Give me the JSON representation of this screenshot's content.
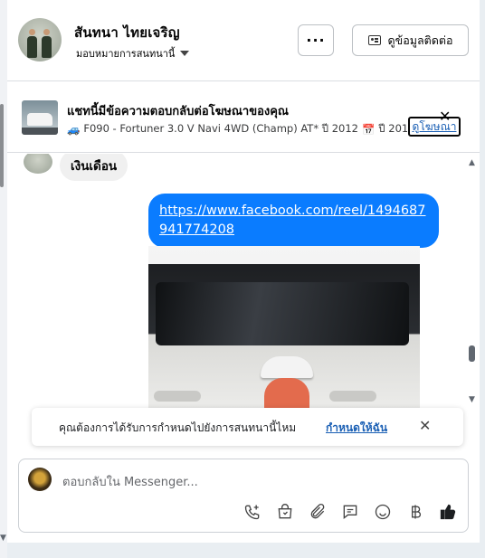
{
  "header": {
    "contact_name": "สันทนา ไทยเจริญ",
    "assign_label": "มอบหมายการสนทนานี้",
    "more_label": "···",
    "contact_info_label": "ดูข้อมูลติดต่อ"
  },
  "ad_banner": {
    "title": "แชทนี้มีข้อความตอบกลับต่อโฆษณาของคุณ",
    "subtitle_part1": "F090 - Fortuner 3.0 V Navi 4WD (Champ) AT* ปี 2012",
    "subtitle_part2": "ปี 201...",
    "view_ad_label": "ดูโฆษณา",
    "close_label": "✕"
  },
  "messages": [
    {
      "sender": "contact",
      "text": "เงินเดือน"
    },
    {
      "sender": "page",
      "text": "https://www.facebook.com/reel/1494687941774208"
    }
  ],
  "notice": {
    "text": "คุณต้องการได้รับการกำหนดไปยังการสนทนานี้ไหม",
    "action_label": "กำหนดให้ฉัน",
    "close_label": "✕"
  },
  "composer": {
    "placeholder": "ตอบกลับใน Messenger..."
  },
  "icons": {
    "header_card": "contact-card-icon",
    "tools": [
      "call-add-icon",
      "shopping-bag-icon",
      "paperclip-icon",
      "saved-reply-icon",
      "emoji-icon",
      "baht-icon",
      "like-icon"
    ]
  },
  "colors": {
    "accent": "#0a7cff",
    "link": "#1a5fb4"
  }
}
